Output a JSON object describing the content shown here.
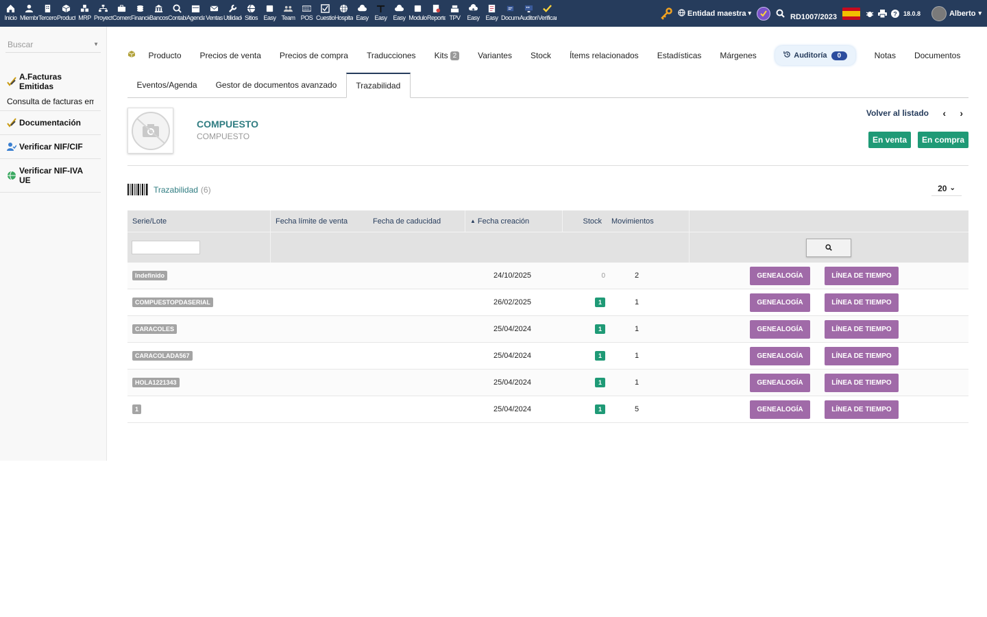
{
  "topbar": {
    "modules": [
      {
        "label": "Inicio",
        "icon": "home-icon"
      },
      {
        "label": "Miembros",
        "icon": "members-icon"
      },
      {
        "label": "Terceros",
        "icon": "building-icon"
      },
      {
        "label": "Productos",
        "icon": "cube-icon"
      },
      {
        "label": "MRP",
        "icon": "cubes-icon"
      },
      {
        "label": "Proyectos",
        "icon": "sitemap-icon"
      },
      {
        "label": "Comercial",
        "icon": "briefcase-icon"
      },
      {
        "label": "Financiera",
        "icon": "coins-icon"
      },
      {
        "label": "Bancos",
        "icon": "bank-icon"
      },
      {
        "label": "Contabilidad",
        "icon": "search-dollar-icon"
      },
      {
        "label": "Agenda",
        "icon": "calendar-icon"
      },
      {
        "label": "Ventas",
        "icon": "mail-icon"
      },
      {
        "label": "Utilidades",
        "icon": "wrench-icon"
      },
      {
        "label": "Sitios",
        "icon": "globe-icon"
      },
      {
        "label": "Easy",
        "icon": "note-icon"
      },
      {
        "label": "Team",
        "icon": "team-icon"
      },
      {
        "label": "POS",
        "icon": "keyboard-icon"
      },
      {
        "label": "Cuestionarios",
        "icon": "checkbox-icon"
      },
      {
        "label": "Hospital",
        "icon": "globe-grid-icon"
      },
      {
        "label": "Easy",
        "icon": "cloud-icon"
      },
      {
        "label": "Easy",
        "icon": "text-t-icon"
      },
      {
        "label": "Easy",
        "icon": "cloud-icon"
      },
      {
        "label": "Modulo",
        "icon": "note-icon"
      },
      {
        "label": "Reportes",
        "icon": "report-icon"
      },
      {
        "label": "TPV",
        "icon": "cash-register-icon"
      },
      {
        "label": "Easy",
        "icon": "cloud-upload-icon"
      },
      {
        "label": "Easy",
        "icon": "document-icon"
      },
      {
        "label": "Documentos",
        "icon": "doc-icon"
      },
      {
        "label": "Auditoria",
        "icon": "monitor-icon"
      },
      {
        "label": "Verificar",
        "icon": "check-icon"
      }
    ],
    "entity_label": "Entidad maestra",
    "ref": "RD1007/2023",
    "version": "18.0.8",
    "user": "Alberto"
  },
  "sidebar": {
    "search_placeholder": "Buscar",
    "sections": [
      {
        "title": "A.Facturas Emitidas",
        "sub": "Consulta de facturas emitidas",
        "icon": "check-pencil-icon"
      },
      {
        "title": "Documentación",
        "sub": "",
        "icon": "check-pencil-icon"
      },
      {
        "title": "Verificar NIF/CIF",
        "sub": "",
        "icon": "user-check-icon"
      },
      {
        "title": "Verificar NIF-IVA UE",
        "sub": "",
        "icon": "globe-green-icon"
      }
    ]
  },
  "tabs": {
    "row1": [
      {
        "label": "Producto"
      },
      {
        "label": "Precios de venta"
      },
      {
        "label": "Precios de compra"
      },
      {
        "label": "Traducciones"
      },
      {
        "label": "Kits",
        "count": "2"
      },
      {
        "label": "Variantes"
      },
      {
        "label": "Stock"
      },
      {
        "label": "Ítems relacionados"
      },
      {
        "label": "Estadísticas"
      },
      {
        "label": "Márgenes"
      }
    ],
    "audit": {
      "label": "Auditoría",
      "count": "0"
    },
    "row1_after": [
      {
        "label": "Notas"
      },
      {
        "label": "Documentos"
      }
    ],
    "row2": [
      {
        "label": "Eventos/Agenda"
      },
      {
        "label": "Gestor de documentos avanzado"
      },
      {
        "label": "Trazabilidad",
        "active": true
      }
    ]
  },
  "product": {
    "ref": "COMPUESTO",
    "label": "COMPUESTO",
    "back_link": "Volver al listado",
    "status_sell": "En venta",
    "status_buy": "En compra"
  },
  "traceability": {
    "title": "Trazabilidad",
    "count": "(6)",
    "page_size": "20",
    "columns": [
      "Serie/Lote",
      "Fecha límite de venta",
      "Fecha de caducidad",
      "Fecha creación",
      "Stock",
      "Movimientos"
    ],
    "btn_genealogy": "GENEALOGÍA",
    "btn_timeline": "LÍNEA DE TIEMPO",
    "rows": [
      {
        "lot": "Indefinido",
        "sell_by": "",
        "expiry": "",
        "created": "24/10/2025",
        "stock": "0",
        "moves": "2"
      },
      {
        "lot": "COMPUESTOPDASERIAL",
        "sell_by": "",
        "expiry": "",
        "created": "26/02/2025",
        "stock": "1",
        "moves": "1"
      },
      {
        "lot": "CARACOLES",
        "sell_by": "",
        "expiry": "",
        "created": "25/04/2024",
        "stock": "1",
        "moves": "1"
      },
      {
        "lot": "CARACOLADA567",
        "sell_by": "",
        "expiry": "",
        "created": "25/04/2024",
        "stock": "1",
        "moves": "1"
      },
      {
        "lot": "HOLA1221343",
        "sell_by": "",
        "expiry": "",
        "created": "25/04/2024",
        "stock": "1",
        "moves": "1"
      },
      {
        "lot": "1",
        "sell_by": "",
        "expiry": "",
        "created": "25/04/2024",
        "stock": "1",
        "moves": "5"
      }
    ]
  },
  "colors": {
    "topbar": "#263c5c",
    "accent_green": "#1f9a76",
    "violet_button": "#a06aa8",
    "teal_text": "#2f7c81"
  }
}
